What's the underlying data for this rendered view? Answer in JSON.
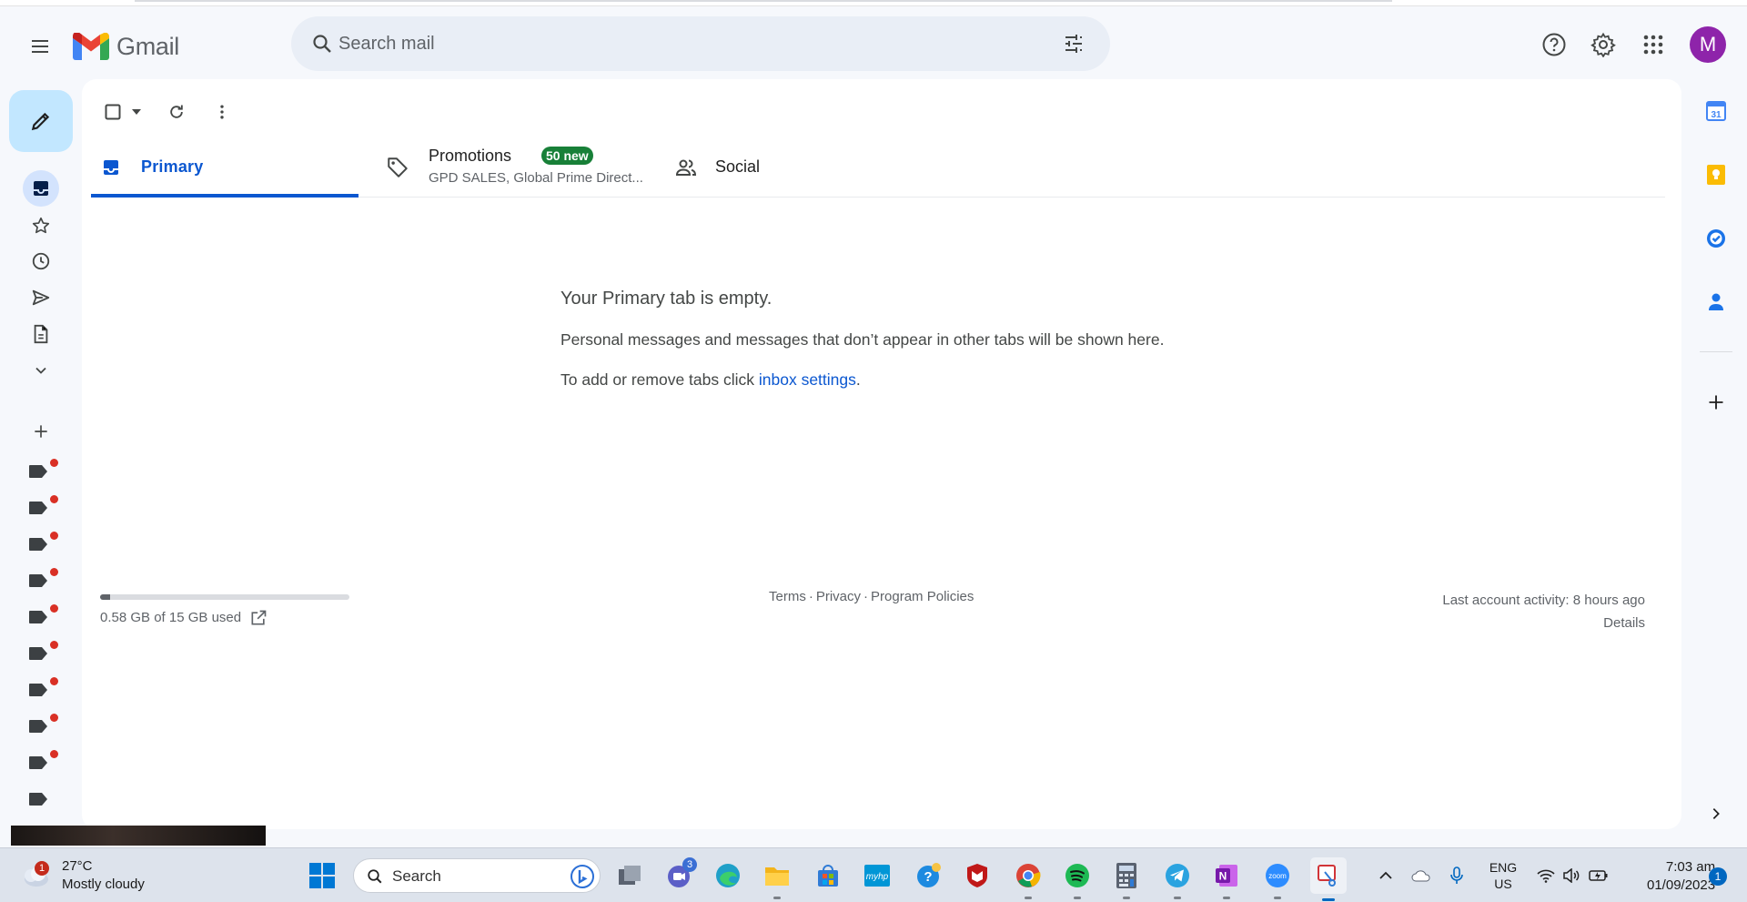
{
  "header": {
    "app_name": "Gmail",
    "search_placeholder": "Search mail",
    "avatar_initial": "M"
  },
  "toolbar": {},
  "tabs": [
    {
      "label": "Primary",
      "active": true
    },
    {
      "label": "Promotions",
      "badge": "50 new",
      "subtitle": "GPD SALES, Global Prime Direct..."
    },
    {
      "label": "Social"
    }
  ],
  "empty_state": {
    "title": "Your Primary tab is empty.",
    "line1": "Personal messages and messages that don’t appear in other tabs will be shown here.",
    "line2_prefix": "To add or remove tabs click ",
    "line2_link": "inbox settings",
    "line2_suffix": "."
  },
  "footer": {
    "storage_text": "0.58 GB of 15 GB used",
    "storage_fraction": 0.039,
    "links": [
      "Terms",
      "Privacy",
      "Program Policies"
    ],
    "activity": "Last account activity: 8 hours ago",
    "details": "Details"
  },
  "right_panel": {
    "calendar_day": "31"
  },
  "taskbar": {
    "weather_temp": "27°C",
    "weather_desc": "Mostly cloudy",
    "weather_badge": "1",
    "search_label": "Search",
    "teams_badge": "3",
    "lang_line1": "ENG",
    "lang_line2": "US",
    "time": "7:03 am",
    "date": "01/09/2023",
    "notification_count": "1"
  },
  "colors": {
    "accent": "#0b57d0",
    "compose_bg": "#c2e7ff",
    "badge_green": "#188038",
    "label_dot": "#d93025",
    "avatar_bg": "#8e24aa"
  }
}
